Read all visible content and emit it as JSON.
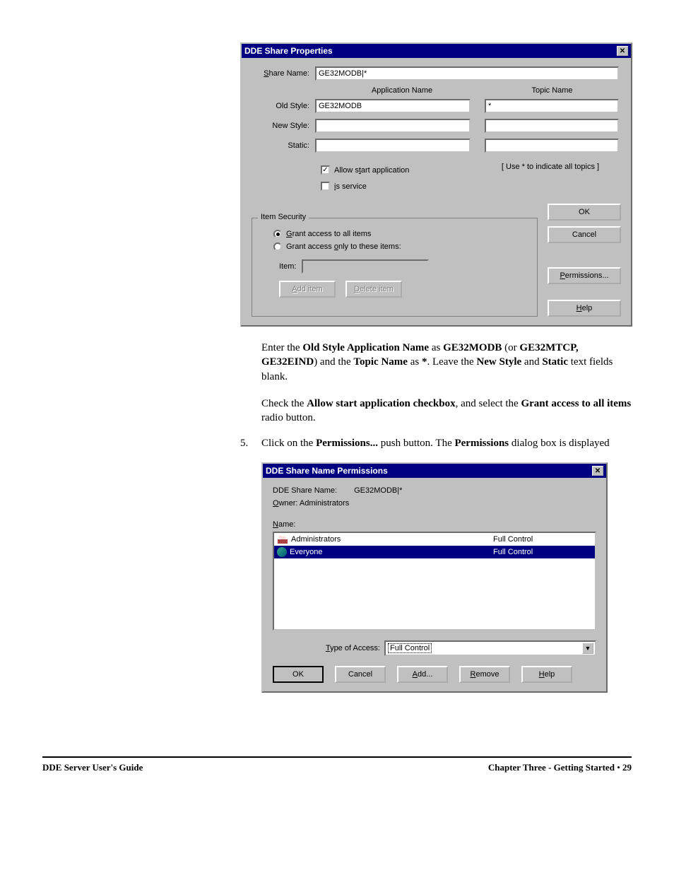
{
  "dialog1": {
    "title": "DDE Share Properties",
    "share_name_label": "Share Name:",
    "share_name_value": "GE32MODB|*",
    "col_app": "Application Name",
    "col_topic": "Topic Name",
    "old_style_label": "Old Style:",
    "old_style_app": "GE32MODB",
    "old_style_topic": "*",
    "new_style_label": "New Style:",
    "new_style_app": "",
    "new_style_topic": "",
    "static_label": "Static:",
    "static_app": "",
    "static_topic": "",
    "allow_start_label": "Allow start application",
    "is_service_label": "is service",
    "topic_hint": "[ Use * to indicate all topics ]",
    "group_title": "Item Security",
    "grant_all_label": "Grant access to all items",
    "grant_only_label": "Grant access only to these items:",
    "item_label": "Item:",
    "add_item_btn": "Add item",
    "delete_item_btn": "Delete item",
    "ok": "OK",
    "cancel": "Cancel",
    "permissions": "Permissions...",
    "help": "Help"
  },
  "para1_a": "Enter the ",
  "para1_b": "Old Style Application Name",
  "para1_c": " as ",
  "para1_d": "GE32MODB",
  "para1_e": " (or ",
  "para1_f": "GE32MTCP, GE32EIND",
  "para1_g": ") and the ",
  "para1_h": "Topic Name",
  "para1_i": " as ",
  "para1_j": "*",
  "para1_k": ". Leave the ",
  "para1_l": "New Style",
  "para1_m": " and ",
  "para1_n": "Static",
  "para1_o": " text fields blank.",
  "para2_a": "Check the ",
  "para2_b": "Allow start application checkbox",
  "para2_c": ", and select the ",
  "para2_d": "Grant access to all items",
  "para2_e": " radio button.",
  "step5_num": "5.",
  "step5_a": "Click on the ",
  "step5_b": "Permissions...",
  "step5_c": " push button. The ",
  "step5_d": "Permissions",
  "step5_e": " dialog box is displayed",
  "dialog2": {
    "title": "DDE Share Name Permissions",
    "share_name_label": "DDE Share Name:",
    "share_name_value": "GE32MODB|*",
    "owner_label": "Owner: Administrators",
    "name_label": "Name:",
    "items": [
      {
        "name": "Administrators",
        "perm": "Full Control"
      },
      {
        "name": "Everyone",
        "perm": "Full Control"
      }
    ],
    "type_label": "Type of Access:",
    "type_value": "Full Control",
    "ok": "OK",
    "cancel": "Cancel",
    "add": "Add...",
    "remove": "Remove",
    "help": "Help"
  },
  "footer": {
    "left": "DDE Server User's Guide",
    "chapter": "Chapter Three - Getting Started",
    "sep": "  •  ",
    "page": "29"
  }
}
